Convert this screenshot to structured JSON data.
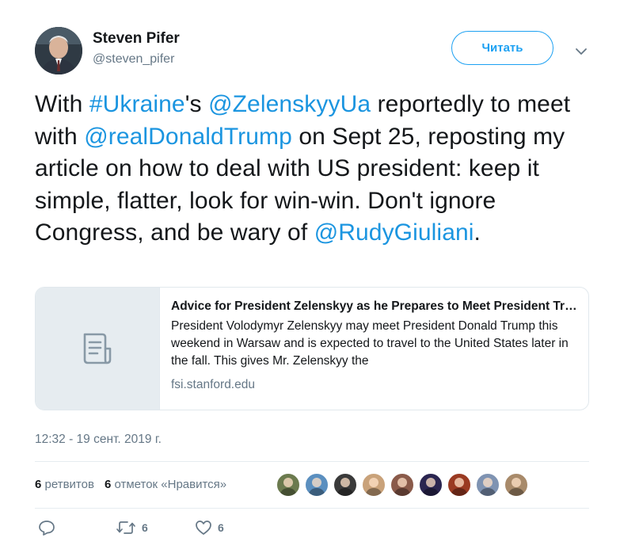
{
  "author": {
    "name": "Steven Pifer",
    "handle": "@steven_pifer"
  },
  "header": {
    "follow_label": "Читать"
  },
  "tweet": {
    "segments": [
      {
        "text": "With ",
        "type": "text"
      },
      {
        "text": "#Ukraine",
        "type": "hashtag"
      },
      {
        "text": "'s ",
        "type": "text"
      },
      {
        "text": "@ZelenskyyUa",
        "type": "mention"
      },
      {
        "text": " reportedly to meet with ",
        "type": "text"
      },
      {
        "text": "@realDonaldTrump",
        "type": "mention"
      },
      {
        "text": " on Sept 25, reposting my article on how to deal with US president: keep it simple, flatter, look for win-win. Don't ignore Congress, and be wary of ",
        "type": "text"
      },
      {
        "text": "@RudyGiuliani",
        "type": "mention"
      },
      {
        "text": ".",
        "type": "text"
      }
    ]
  },
  "card": {
    "title": "Advice for President Zelenskyy as he Prepares to Meet President Trump",
    "description": "President Volodymyr Zelenskyy may meet President Donald Trump this weekend in Warsaw and is expected to travel to the United States later in the fall.  This gives Mr. Zelenskyy the",
    "domain": "fsi.stanford.edu",
    "thumb_icon": "document-icon"
  },
  "meta": {
    "timestamp": "12:32 - 19 сент. 2019 г."
  },
  "stats": {
    "retweets_count": "6",
    "retweets_label": "ретвитов",
    "likes_count": "6",
    "likes_label": "отметок «Нравится»"
  },
  "likers": [
    {
      "tone": "#6b7a4e"
    },
    {
      "tone": "#5b8fbf"
    },
    {
      "tone": "#3a3a3a"
    },
    {
      "tone": "#c9a27a"
    },
    {
      "tone": "#8a5a4a"
    },
    {
      "tone": "#2a2550"
    },
    {
      "tone": "#9a3a22"
    },
    {
      "tone": "#7f93b2"
    },
    {
      "tone": "#a88a6a"
    }
  ],
  "actions": {
    "reply_count": "",
    "retweet_count": "6",
    "like_count": "6"
  },
  "colors": {
    "accent": "#1da1f2",
    "link": "#1b95e0",
    "muted": "#657786",
    "text": "#14171a",
    "border": "#e1e8ed"
  }
}
